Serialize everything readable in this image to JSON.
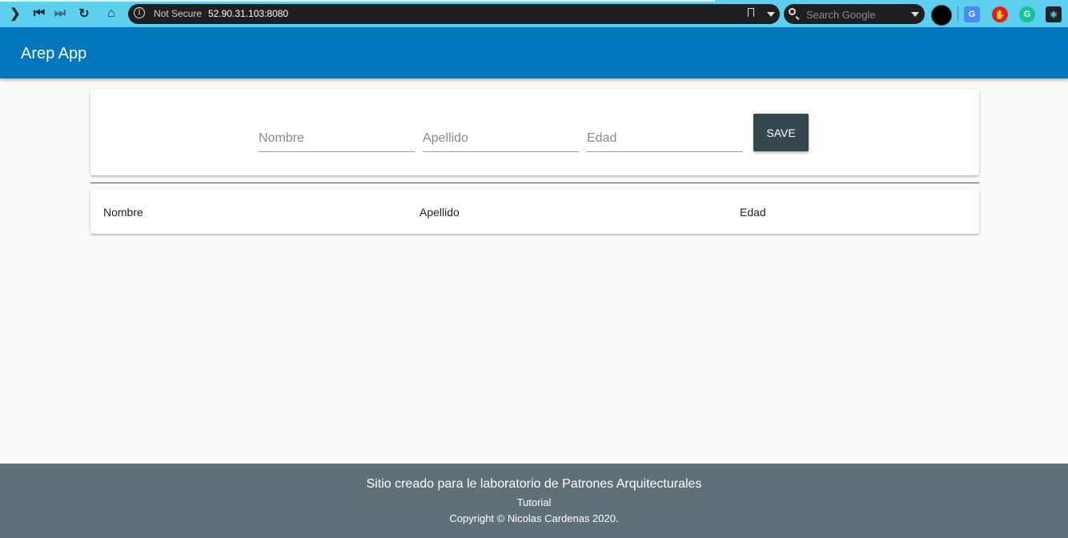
{
  "browser": {
    "security_label": "Not Secure",
    "url": "52.90.31.103:8080",
    "search_placeholder": "Search Google"
  },
  "app": {
    "title": "Arep App",
    "accent_color": "#0277bd"
  },
  "form": {
    "fields": [
      {
        "placeholder": "Nombre",
        "value": ""
      },
      {
        "placeholder": "Apellido",
        "value": ""
      },
      {
        "placeholder": "Edad",
        "value": ""
      }
    ],
    "save_label": "SAVE"
  },
  "table": {
    "columns": [
      "Nombre",
      "Apellido",
      "Edad"
    ],
    "rows": []
  },
  "footer": {
    "line1": "Sitio creado para le laboratorio de Patrones Arquitecturales",
    "line2": "Tutorial",
    "line3": "Copyright © Nicolas Cardenas 2020.",
    "color": "#607078"
  }
}
